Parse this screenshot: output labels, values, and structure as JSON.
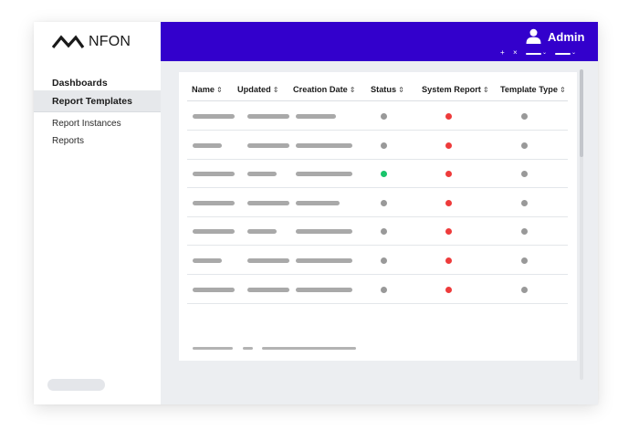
{
  "brand": {
    "name": "NFON",
    "logo_icon": "nfon-logo-mark"
  },
  "header": {
    "user_name": "Admin",
    "user_icon": "user-icon",
    "background": "#3300CC",
    "plus": "+",
    "close": "×"
  },
  "sidebar": {
    "heading": "Dashboards",
    "active_item": "Report Templates",
    "items": [
      {
        "label": "Report Instances"
      },
      {
        "label": "Reports"
      }
    ]
  },
  "table": {
    "columns": [
      {
        "label": "Name"
      },
      {
        "label": "Updated"
      },
      {
        "label": "Creation Date"
      },
      {
        "label": "Status"
      },
      {
        "label": "System Report"
      },
      {
        "label": "Template Type"
      }
    ],
    "sort_glyph": "⇕",
    "rows": [
      {
        "status": "gray",
        "system_report": "red",
        "template_type": "gray"
      },
      {
        "status": "gray",
        "system_report": "red",
        "template_type": "gray"
      },
      {
        "status": "green",
        "system_report": "red",
        "template_type": "gray"
      },
      {
        "status": "gray",
        "system_report": "red",
        "template_type": "gray"
      },
      {
        "status": "gray",
        "system_report": "red",
        "template_type": "gray"
      },
      {
        "status": "gray",
        "system_report": "red",
        "template_type": "gray"
      },
      {
        "status": "gray",
        "system_report": "red",
        "template_type": "gray"
      }
    ]
  },
  "colors": {
    "gray": "#999999",
    "red": "#ee3b3b",
    "green": "#19c46b",
    "accent": "#3300CC"
  }
}
